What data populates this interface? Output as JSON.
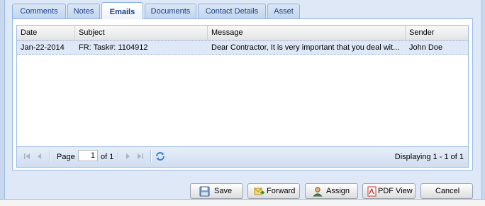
{
  "tabs": [
    {
      "label": "Comments"
    },
    {
      "label": "Notes"
    },
    {
      "label": "Emails"
    },
    {
      "label": "Documents"
    },
    {
      "label": "Contact Details"
    },
    {
      "label": "Asset"
    }
  ],
  "active_tab": "Emails",
  "grid": {
    "columns": [
      {
        "label": "Date"
      },
      {
        "label": "Subject"
      },
      {
        "label": "Message"
      },
      {
        "label": "Sender"
      }
    ],
    "rows": [
      {
        "date": "Jan-22-2014",
        "subject": "FR: Task#: 1104912",
        "message": "Dear Contractor, It is very important that you deal wit...",
        "sender": "John Doe"
      }
    ]
  },
  "pager": {
    "page_label": "Page",
    "page_value": "1",
    "of_label": "of 1",
    "display_msg": "Displaying 1 - 1 of 1",
    "icons": [
      "first-page-icon",
      "prev-page-icon",
      "next-page-icon",
      "last-page-icon",
      "refresh-icon"
    ]
  },
  "buttons": {
    "save": "Save",
    "forward": "Forward",
    "assign": "Assign",
    "pdf_view": "PDF View",
    "cancel": "Cancel"
  },
  "colors": {
    "tab_text": "#15428b",
    "border_blue": "#99bbe8",
    "selected_row": "#dfe8f6",
    "window_bg": "#dfe8f6"
  }
}
